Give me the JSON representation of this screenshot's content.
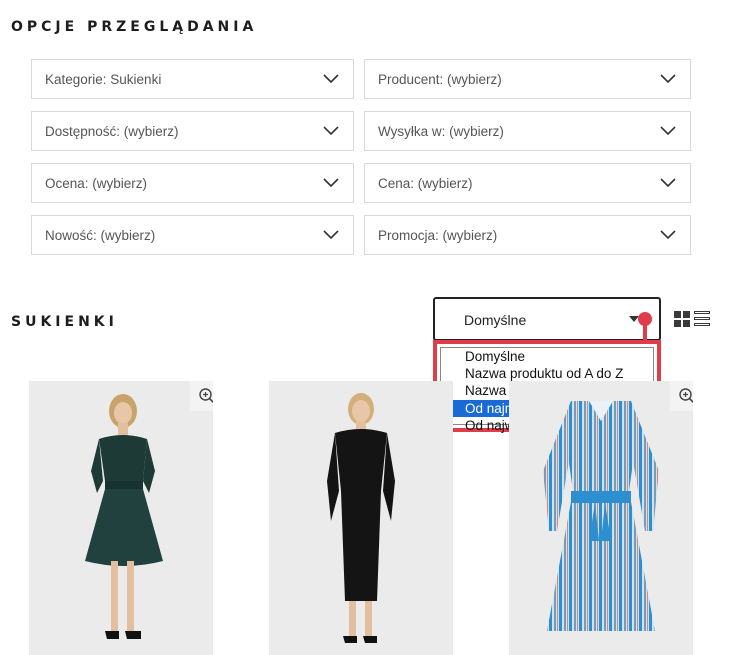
{
  "browse_options": {
    "title": "OPCJE PRZEGLĄDANIA",
    "filters": [
      {
        "label": "Kategorie: Sukienki"
      },
      {
        "label": "Producent: (wybierz)"
      },
      {
        "label": "Dostępność: (wybierz)"
      },
      {
        "label": "Wysyłka w: (wybierz)"
      },
      {
        "label": "Ocena: (wybierz)"
      },
      {
        "label": "Cena: (wybierz)"
      },
      {
        "label": "Nowość: (wybierz)"
      },
      {
        "label": "Promocja: (wybierz)"
      }
    ]
  },
  "products_section": {
    "title": "SUKIENKI"
  },
  "sort": {
    "selected": "Domyślne",
    "options": [
      {
        "label": "Domyślne"
      },
      {
        "label": "Nazwa produktu od A do Z"
      },
      {
        "label": "Nazwa produktu od Z do A"
      },
      {
        "label": "Od najniższej ceny",
        "highlighted": true
      },
      {
        "label": "Od najwyższej ceny"
      }
    ]
  },
  "view_toggle": [
    "grid-view-icon",
    "list-view-icon"
  ],
  "products": [
    {
      "name": "dark green off-shoulder dress",
      "image": "product-photo"
    },
    {
      "name": "black fitted dress",
      "image": "product-photo"
    },
    {
      "name": "blue striped shirt dress",
      "image": "product-photo"
    }
  ],
  "colors": {
    "highlight": "#1a6ad6",
    "annotation_red": "#e03c4a",
    "border": "#d9d9d9"
  }
}
